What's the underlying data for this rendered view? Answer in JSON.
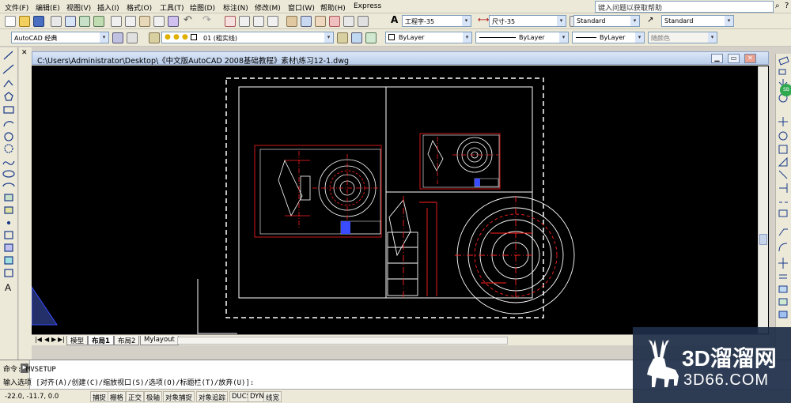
{
  "menu": {
    "items": [
      "文件(F)",
      "编辑(E)",
      "视图(V)",
      "插入(I)",
      "格式(O)",
      "工具(T)",
      "绘图(D)",
      "标注(N)",
      "修改(M)",
      "窗口(W)",
      "帮助(H)",
      "Express"
    ],
    "help_search": "键入问题以获取帮助"
  },
  "toolbar": {
    "text_style": "工程字-35",
    "dim_style": "尺寸-35",
    "table_style": "Standard",
    "multileader_style": "Standard",
    "workspace": "AutoCAD 经典",
    "layer": "01 (粗实线)",
    "color": "ByLayer",
    "linetype": "ByLayer",
    "lineweight": "ByLayer",
    "plot_style": "随颜色"
  },
  "document": {
    "path": "C:\\Users\\Administrator\\Desktop\\《中文版AutoCAD 2008基础教程》素材\\练习12-1.dwg"
  },
  "layout_tabs": [
    "模型",
    "布局1",
    "布局2",
    "Mylayout"
  ],
  "command": {
    "line1": "命令: MVSETUP",
    "line2": "输入选项 [对齐(A)/创建(C)/缩放视口(S)/选项(O)/标题栏(T)/放弃(U)]:"
  },
  "status": {
    "coords": "-22.0, -11.7, 0.0",
    "buttons": [
      "捕捉",
      "栅格",
      "正交",
      "极轴",
      "对象捕捉",
      "对象追踪",
      "DUCS",
      "DYN",
      "线宽"
    ]
  },
  "watermark": {
    "brand": "3D溜溜网",
    "url": "3D66.COM"
  },
  "colors": {
    "canvas": "#000000",
    "drawing_white": "#ffffff",
    "drawing_red": "#ff2020",
    "drawing_blue": "#3a4cff"
  }
}
